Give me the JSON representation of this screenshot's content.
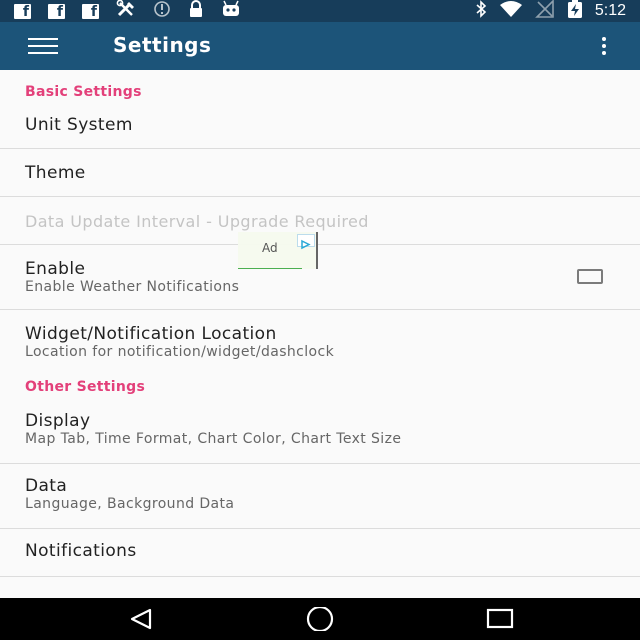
{
  "status_bar": {
    "time": "5:12",
    "fb_letter": "f",
    "icons_left": [
      "facebook-icon",
      "facebook-icon",
      "facebook-icon",
      "tools-icon",
      "sync-icon",
      "lock-icon",
      "android-icon"
    ],
    "icons_right": [
      "bluetooth-icon",
      "wifi-icon",
      "no-signal-icon",
      "battery-charging-icon"
    ]
  },
  "app_bar": {
    "title": "Settings",
    "nav_icon": "menu-icon",
    "overflow_icon": "more-vert-icon",
    "color": "#1c5479",
    "status_color": "#173d5a"
  },
  "ad": {
    "label": "Ad"
  },
  "sections": {
    "basic": {
      "title": "Basic Settings",
      "unit_system": {
        "title": "Unit System"
      },
      "theme": {
        "title": "Theme"
      },
      "update_interval": {
        "title": "Data Update Interval - Upgrade Required"
      },
      "enable": {
        "title": "Enable",
        "summary": "Enable Weather Notifications",
        "checked": false
      },
      "location": {
        "title": "Widget/Notification Location",
        "summary": "Location for notification/widget/dashclock"
      }
    },
    "other": {
      "title": "Other Settings",
      "display": {
        "title": "Display",
        "summary": "Map Tab, Time Format, Chart Color, Chart Text Size"
      },
      "data": {
        "title": "Data",
        "summary": "Language, Background Data"
      },
      "notifications": {
        "title": "Notifications"
      }
    }
  },
  "accent_color": "#e3407a",
  "nav_bar": {
    "buttons": [
      "back-icon",
      "home-icon",
      "recents-icon"
    ]
  }
}
